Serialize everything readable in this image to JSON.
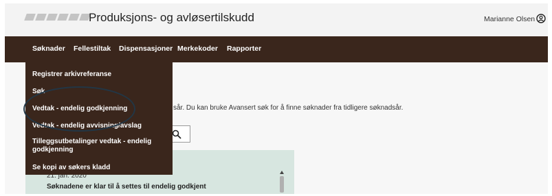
{
  "header": {
    "title": "Produksjons- og avløsertilskudd",
    "user_name": "Marianne Olsen"
  },
  "nav": {
    "items": [
      {
        "label": "Søknader"
      },
      {
        "label": "Fellestiltak"
      },
      {
        "label": "Dispensasjoner"
      },
      {
        "label": "Merkekoder"
      },
      {
        "label": "Rapporter"
      }
    ]
  },
  "dropdown": {
    "items": [
      {
        "label": "Registrer arkivreferanse"
      },
      {
        "label": "Søk"
      },
      {
        "label": "Vedtak - endelig godkjenning"
      },
      {
        "label": "Vedtak - endelig avvisning/avslag"
      },
      {
        "label": "Tilleggsutbetalinger vedtak - endelig godkjenning"
      },
      {
        "label": "Se kopi av søkers kladd"
      }
    ]
  },
  "content": {
    "info_text": "sår. Du kan bruke Avansert søk for å finne søknader fra tidligere søknadsår.",
    "result_date": "21. jan. 2020",
    "result_status": "Søknadene er klar til å settes til endelig godkjent"
  }
}
